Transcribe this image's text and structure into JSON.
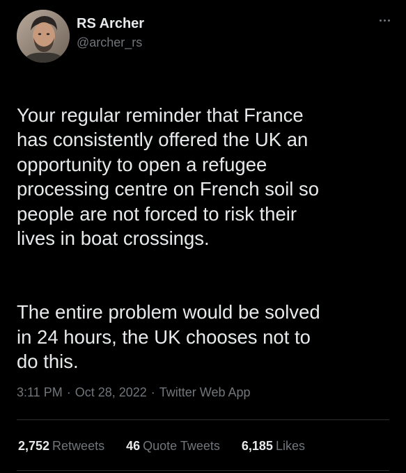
{
  "colors": {
    "background": "#000000",
    "text_primary": "#e7e9ea",
    "text_secondary": "#71767b",
    "divider": "#2f3336"
  },
  "author": {
    "display_name": "RS Archer",
    "handle": "@archer_rs",
    "avatar_icon": "profile-photo"
  },
  "menu": {
    "icon": "more-dots-icon"
  },
  "tweet": {
    "paragraphs": [
      "Your regular reminder that France\nhas consistently offered the UK an\nopportunity to open a refugee\nprocessing centre on French soil so\npeople are not forced to risk their\nlives in boat crossings.",
      "The entire problem would be solved\nin 24 hours, the UK chooses not to\ndo this."
    ]
  },
  "meta": {
    "time": "3:11 PM",
    "date": "Oct 28, 2022",
    "source": "Twitter Web App",
    "separator": "·"
  },
  "stats": {
    "retweets": {
      "count": "2,752",
      "label": "Retweets"
    },
    "quotes": {
      "count": "46",
      "label": "Quote Tweets"
    },
    "likes": {
      "count": "6,185",
      "label": "Likes"
    }
  }
}
